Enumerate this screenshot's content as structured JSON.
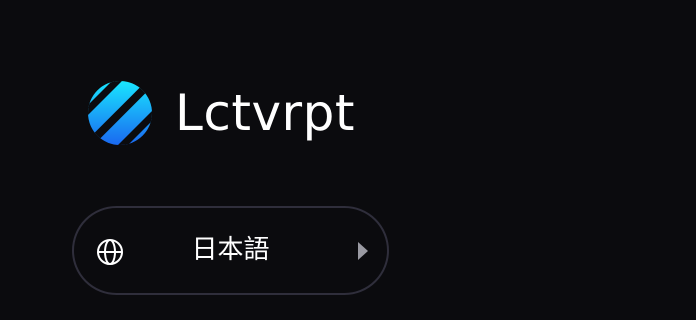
{
  "brand": {
    "name": "Lctvrpt",
    "logo_icon": "brand-logo-icon",
    "logo_gradient": [
      "#19e8ff",
      "#1a66f0"
    ]
  },
  "language_selector": {
    "label": "日本語",
    "leading_icon": "globe-icon",
    "trailing_icon": "caret-right-icon",
    "border_color": "#2f2e3b"
  },
  "colors": {
    "background": "#0b0b0e",
    "text": "#ffffff",
    "caret": "#9a9aa2"
  }
}
